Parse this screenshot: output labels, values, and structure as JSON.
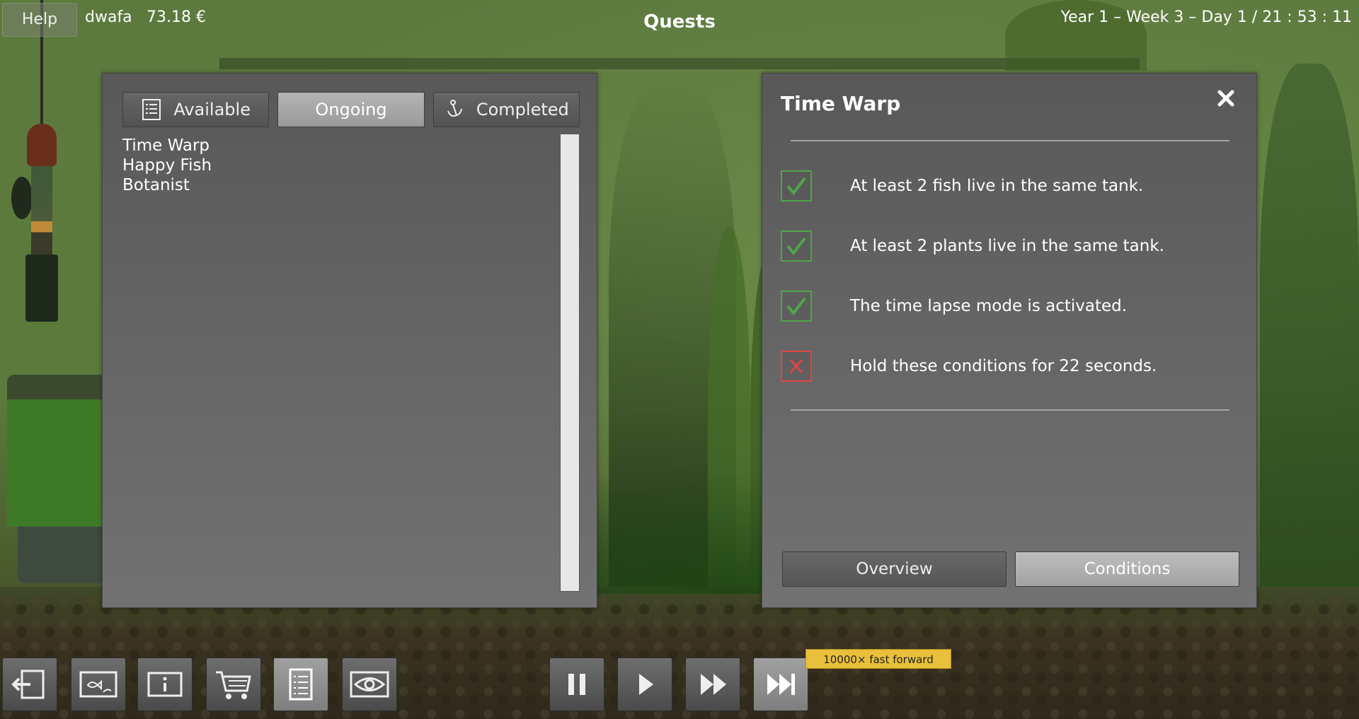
{
  "topbar": {
    "help_label": "Help",
    "player_name": "dwafa",
    "money": "73.18 €",
    "screen_title": "Quests",
    "datetime": "Year 1 – Week 3 – Day 1  /  21 : 53 : 11"
  },
  "quests": {
    "tabs": [
      {
        "label": "Available",
        "icon": "list-icon",
        "active": false
      },
      {
        "label": "Ongoing",
        "icon": "",
        "active": true
      },
      {
        "label": "Completed",
        "icon": "anchor-icon",
        "active": false
      }
    ],
    "list": [
      "Time Warp",
      "Happy Fish",
      "Botanist"
    ]
  },
  "detail": {
    "title": "Time Warp",
    "conditions": [
      {
        "text": "At least 2 fish live in the same tank.",
        "met": true
      },
      {
        "text": "At least 2 plants live in the same tank.",
        "met": true
      },
      {
        "text": "The time lapse mode is activated.",
        "met": true
      },
      {
        "text": "Hold these conditions for 22 seconds.",
        "met": false
      }
    ],
    "buttons": {
      "overview": "Overview",
      "conditions": "Conditions"
    },
    "active_view": "Conditions"
  },
  "toolbar": {
    "left_buttons": [
      "exit-icon",
      "tank-icon",
      "info-icon",
      "cart-icon",
      "quests-icon",
      "eye-icon"
    ],
    "active": "quests-icon",
    "speed_buttons": [
      "pause-icon",
      "play-icon",
      "fast-forward-icon",
      "max-speed-icon"
    ],
    "speed_tooltip": "10000× fast forward"
  },
  "colors": {
    "check_ok": "#4fa54a",
    "check_fail": "#e04444",
    "tooltip": "#e8c03a"
  }
}
